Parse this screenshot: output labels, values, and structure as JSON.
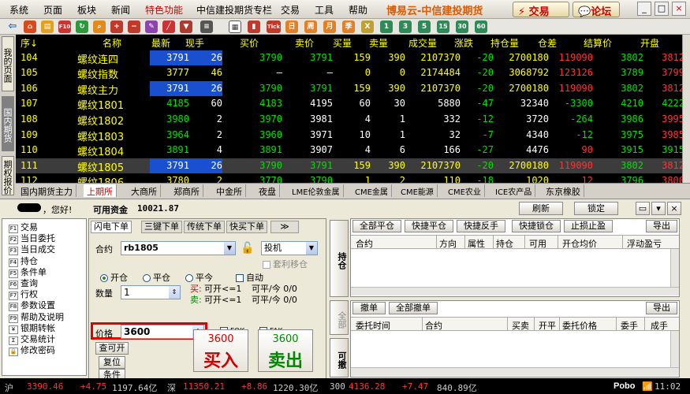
{
  "menu": [
    "系统",
    "页面",
    "板块",
    "新闻",
    "特色功能",
    "中信建投期货专栏",
    "交易",
    "工具",
    "帮助"
  ],
  "brand": "博易云-中信建投期货",
  "top_buttons": {
    "trade": "交易",
    "forum": "论坛"
  },
  "window_controls": [
    "_",
    "□",
    "×"
  ],
  "toolbar_text": {
    "tick": "Tick",
    "day": "日",
    "week": "周",
    "month": "月",
    "season": "季",
    "n1": "1",
    "n3": "3",
    "n5": "5",
    "n15": "15",
    "n30": "30",
    "n60": "60",
    "x": "X"
  },
  "side_tabs": [
    "我的页面",
    "国内期货",
    "期权报价"
  ],
  "quote_headers": [
    "序↓",
    "名称",
    "最新",
    "现手",
    "买价",
    "卖价",
    "买量",
    "卖量",
    "成交量",
    "涨跌",
    "持仓量",
    "仓差",
    "结算价",
    "开盘"
  ],
  "quote_rows": [
    [
      "104",
      "螺纹连四",
      "3791",
      "26",
      "3790",
      "3791",
      "159",
      "390",
      "2107370",
      "-20",
      "2700180",
      "119090",
      "3802",
      "3812"
    ],
    [
      "105",
      "螺纹指数",
      "3777",
      "46",
      "—",
      "—",
      "0",
      "0",
      "2174484",
      "-20",
      "3068792",
      "123126",
      "3789",
      "3799"
    ],
    [
      "106",
      "螺纹主力",
      "3791",
      "26",
      "3790",
      "3791",
      "159",
      "390",
      "2107370",
      "-20",
      "2700180",
      "119090",
      "3802",
      "3812"
    ],
    [
      "107",
      "螺纹1801",
      "4185",
      "60",
      "4183",
      "4195",
      "60",
      "30",
      "5880",
      "-47",
      "32340",
      "-3300",
      "4210",
      "4222"
    ],
    [
      "108",
      "螺纹1802",
      "3980",
      "2",
      "3970",
      "3981",
      "4",
      "1",
      "332",
      "-12",
      "3720",
      "-264",
      "3986",
      "3995"
    ],
    [
      "109",
      "螺纹1803",
      "3964",
      "2",
      "3960",
      "3971",
      "10",
      "1",
      "32",
      "-7",
      "4340",
      "-12",
      "3975",
      "3985"
    ],
    [
      "110",
      "螺纹1804",
      "3891",
      "4",
      "3891",
      "3907",
      "4",
      "6",
      "166",
      "-27",
      "4476",
      "90",
      "3915",
      "3915"
    ],
    [
      "111",
      "螺纹1805",
      "3791",
      "26",
      "3790",
      "3791",
      "159",
      "390",
      "2107370",
      "-20",
      "2700180",
      "119090",
      "3802",
      "3812"
    ],
    [
      "112",
      "螺纹1806",
      "3780",
      "2",
      "3770",
      "3790",
      "1",
      "2",
      "110",
      "-18",
      "1020",
      "12",
      "3796",
      "3800"
    ]
  ],
  "market_tabs": [
    "国内期货主力",
    "上期所",
    "大商所",
    "郑商所",
    "中金所",
    "夜盘",
    "LME伦敦金属",
    "CME金属",
    "CME能源",
    "CME农业",
    "ICE农产品",
    "东京橡胶"
  ],
  "account": {
    "greeting": "，您好!",
    "available_funds_label": "可用资金",
    "available_funds": "10021.87"
  },
  "header_buttons": {
    "refresh": "刷新",
    "lock": "锁定"
  },
  "nav_items": [
    {
      "key": "F1",
      "label": "交易"
    },
    {
      "key": "F2",
      "label": "当日委托"
    },
    {
      "key": "F3",
      "label": "当日成交"
    },
    {
      "key": "F4",
      "label": "持仓"
    },
    {
      "key": "F5",
      "label": "条件单"
    },
    {
      "key": "F6",
      "label": "查询"
    },
    {
      "key": "F7",
      "label": "行权"
    },
    {
      "key": "F8",
      "label": "参数设置"
    },
    {
      "key": "F9",
      "label": "帮助及说明"
    },
    {
      "key": "¥",
      "label": "银期转帐"
    },
    {
      "key": "Σ",
      "label": "交易统计"
    },
    {
      "key": "🔒",
      "label": "修改密码"
    }
  ],
  "order_tabs": [
    "闪电下单",
    "三键下单",
    "传统下单",
    "快买下单"
  ],
  "order": {
    "contract_label": "合约",
    "contract": "rb1805",
    "hedge_type": "投机",
    "arbitrage_label": "套利移仓",
    "open_label": "开仓",
    "close_label": "平仓",
    "close_today_label": "平今",
    "auto_label": "自动",
    "qty_label": "数量",
    "qty": "1",
    "buy_info_label": "买:",
    "buy_open": "可开<=1",
    "buy_close": "可平/今 0/0",
    "sell_info_label": "卖:",
    "sell_open": "可开<=1",
    "sell_close": "可平/今 0/0",
    "price_label": "价格",
    "price": "3600",
    "fok": "FOK",
    "fak": "FAK",
    "query_open": "查可开",
    "restore": "复位",
    "condition": "条件",
    "inquiry": "询价",
    "buy_price": "3600",
    "buy_label": "买入",
    "sell_price": "3600",
    "sell_label": "卖出"
  },
  "positions": {
    "tab_label": "持仓",
    "buttons": [
      "全部平仓",
      "快捷平仓",
      "快捷反手",
      "快捷锁仓",
      "止损止盈"
    ],
    "export": "导出",
    "columns": [
      "合约",
      "方向",
      "属性",
      "持仓",
      "可用",
      "开仓均价",
      "浮动盈亏"
    ]
  },
  "orders": {
    "tab_all": "全部",
    "tab_cancel": "可撤",
    "buttons": [
      "撤单",
      "全部撤单"
    ],
    "export": "导出",
    "columns": [
      "委托时间",
      "合约",
      "买卖",
      "开平",
      "委托价格",
      "委手",
      "成手"
    ]
  },
  "status_bar": [
    {
      "name": "沪",
      "value": "3390.46",
      "change": "+4.75",
      "amount": "1197.64亿"
    },
    {
      "name": "深",
      "value": "11350.21",
      "change": "+8.86",
      "amount": "1220.30亿"
    },
    {
      "name": "300",
      "value": "4136.28",
      "change": "+7.47",
      "amount": "840.89亿"
    }
  ],
  "status_right": {
    "logo": "Pobo",
    "time": "11:02"
  }
}
